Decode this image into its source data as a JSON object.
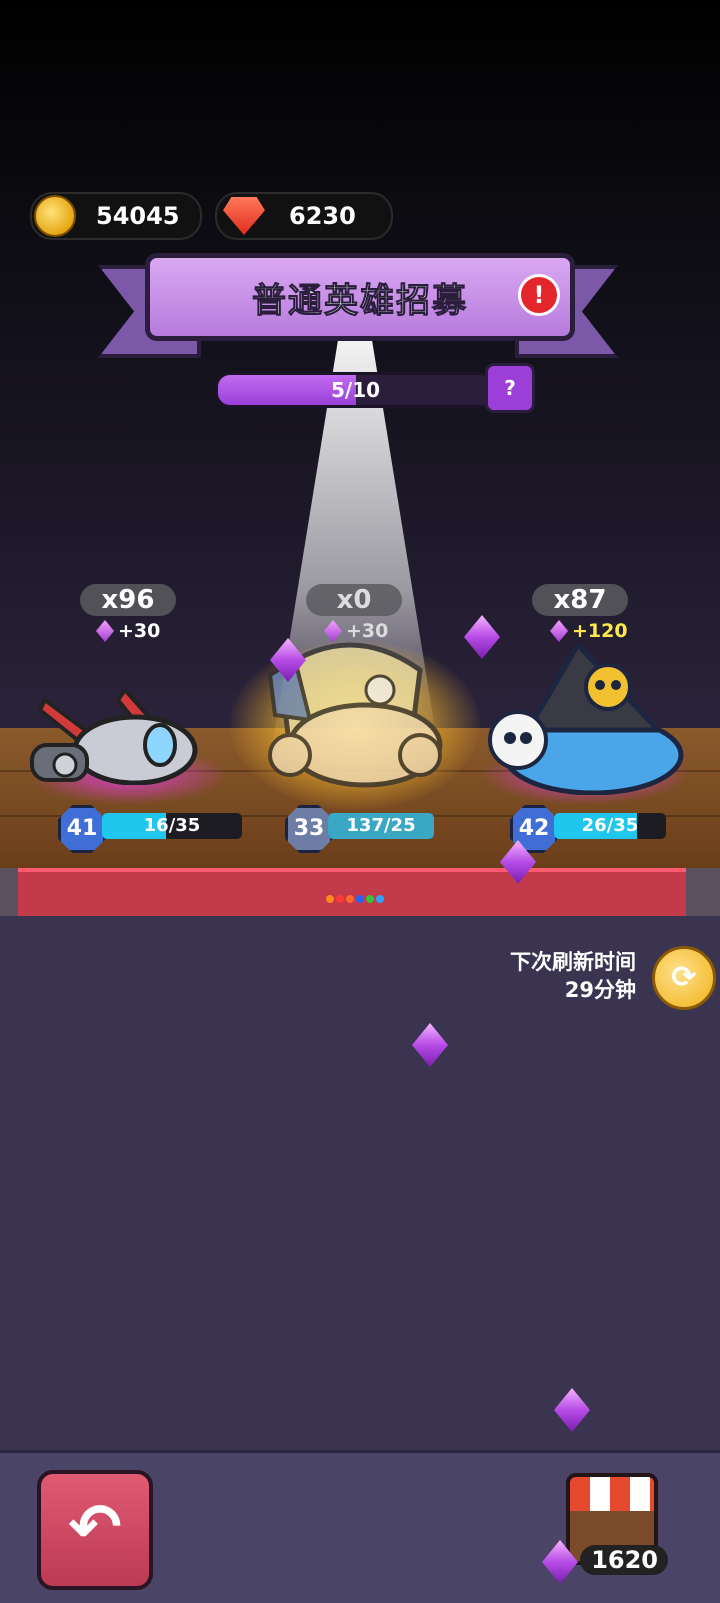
{
  "currency": {
    "gold": "54045",
    "rubies": "6230"
  },
  "banner": {
    "title": "普通英雄招募"
  },
  "progress": {
    "label": "5/10",
    "fraction": 0.5
  },
  "heroes": [
    {
      "count": "x96",
      "bonus": "+30",
      "level": "41",
      "xp": "16/35",
      "xp_fraction": 0.457,
      "bonus_color": "#ffffff"
    },
    {
      "count": "x0",
      "bonus": "+30",
      "level": "33",
      "xp": "137/25",
      "xp_fraction": 1.0,
      "bonus_color": "#ffffff"
    },
    {
      "count": "x87",
      "bonus": "+120",
      "level": "42",
      "xp": "26/35",
      "xp_fraction": 0.743,
      "bonus_color": "#ffe84a"
    }
  ],
  "refresh": {
    "label": "下次刷新时间",
    "time": "29分钟"
  },
  "shop": {
    "price": "1620"
  },
  "colors": {
    "accent_purple": "#9b3fd8",
    "table_red": "#c33a4b",
    "xp_cyan": "#1fc6ee"
  }
}
